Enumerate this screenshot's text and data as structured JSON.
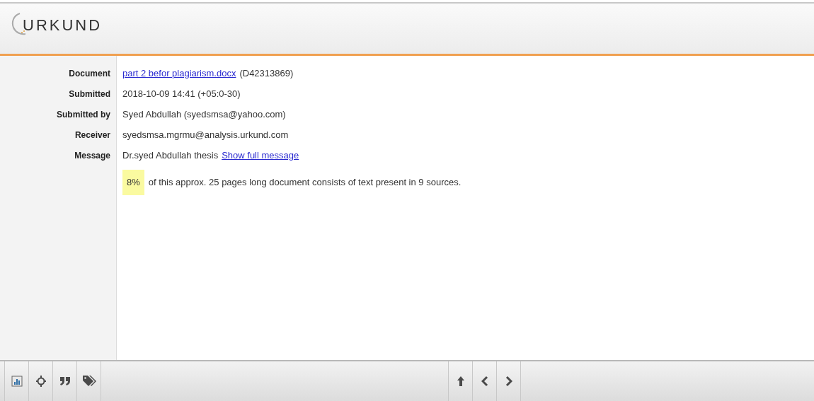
{
  "header": {
    "logo": "URKUND"
  },
  "details": [
    {
      "label": "Document",
      "parts": [
        {
          "kind": "link",
          "text": "part 2 befor plagiarism.docx"
        },
        {
          "kind": "text",
          "text": "(D42313869)"
        }
      ]
    },
    {
      "label": "Submitted",
      "parts": [
        {
          "kind": "text",
          "text": "2018-10-09 14:41 (+05:0-30)"
        }
      ]
    },
    {
      "label": "Submitted by",
      "parts": [
        {
          "kind": "text",
          "text": "Syed Abdullah (syedsmsa@yahoo.com)"
        }
      ]
    },
    {
      "label": "Receiver",
      "parts": [
        {
          "kind": "text",
          "text": "syedsmsa.mgrmu@analysis.urkund.com"
        }
      ]
    },
    {
      "label": "Message",
      "parts": [
        {
          "kind": "text",
          "text": "Dr.syed Abdullah thesis"
        },
        {
          "kind": "link",
          "text": "Show full message"
        }
      ]
    }
  ],
  "summary": {
    "percent": "8%",
    "text": "of this approx. 25 pages long document consists of text present in 9 sources."
  },
  "toolbar": {
    "left": [
      {
        "kind": "chart"
      },
      {
        "kind": "crosshair"
      },
      {
        "kind": "quote"
      },
      {
        "kind": "tags"
      }
    ],
    "right": [
      {
        "kind": "up"
      },
      {
        "kind": "prev"
      },
      {
        "kind": "next"
      }
    ]
  }
}
